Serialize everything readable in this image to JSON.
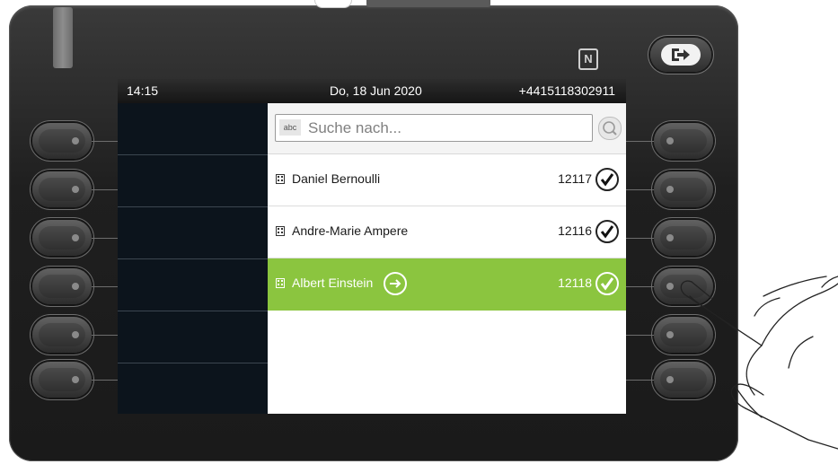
{
  "status_bar": {
    "time": "14:15",
    "date": "Do, 18 Jun 2020",
    "number": "+4415118302911"
  },
  "search": {
    "abc_label": "abc",
    "placeholder": "Suche nach..."
  },
  "contacts": [
    {
      "name": "Daniel Bernoulli",
      "number": "12117",
      "selected": false
    },
    {
      "name": "Andre-Marie Ampere",
      "number": "12116",
      "selected": false
    },
    {
      "name": "Albert Einstein",
      "number": "12118",
      "selected": true
    }
  ],
  "nfc_label": "N",
  "colors": {
    "selected_row": "#8bc53f",
    "left_panel": "#0c141c",
    "status_bar": "#1e1e1e"
  },
  "icons": [
    "nfc-icon",
    "exit-icon",
    "search-icon",
    "building-icon",
    "checkmark-icon",
    "arrow-right-icon"
  ]
}
